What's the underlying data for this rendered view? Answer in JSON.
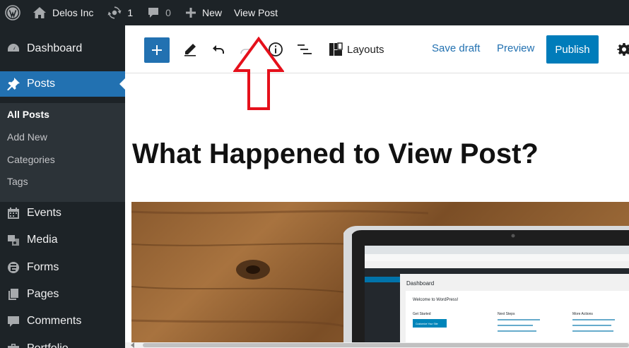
{
  "adminbar": {
    "site_name": "Delos Inc",
    "updates_count": "1",
    "comments_count": "0",
    "new_label": "New",
    "view_post_label": "View Post"
  },
  "sidebar": {
    "items": [
      {
        "label": "Dashboard",
        "icon": "dashboard-icon"
      },
      {
        "label": "Posts",
        "icon": "pin-icon",
        "active": true
      },
      {
        "label": "Events",
        "icon": "calendar-icon"
      },
      {
        "label": "Media",
        "icon": "media-icon"
      },
      {
        "label": "Forms",
        "icon": "forms-icon"
      },
      {
        "label": "Pages",
        "icon": "pages-icon"
      },
      {
        "label": "Comments",
        "icon": "comment-icon"
      },
      {
        "label": "Portfolio",
        "icon": "portfolio-icon"
      }
    ],
    "submenu": [
      "All Posts",
      "Add New",
      "Categories",
      "Tags"
    ]
  },
  "toolbar": {
    "layouts_label": "Layouts",
    "save_draft_label": "Save draft",
    "preview_label": "Preview",
    "publish_label": "Publish"
  },
  "post": {
    "title": "What Happened to View Post?"
  },
  "screen": {
    "inner_heading": "Dashboard",
    "welcome": "Welcome to WordPress!",
    "get_started": "Get Started",
    "next_steps": "Next Steps",
    "more_actions": "More Actions",
    "button": "Customize Your Site"
  },
  "colors": {
    "admin_bg": "#1d2327",
    "accent": "#2271b1",
    "publish": "#007cba",
    "annotation": "#e5101b"
  }
}
